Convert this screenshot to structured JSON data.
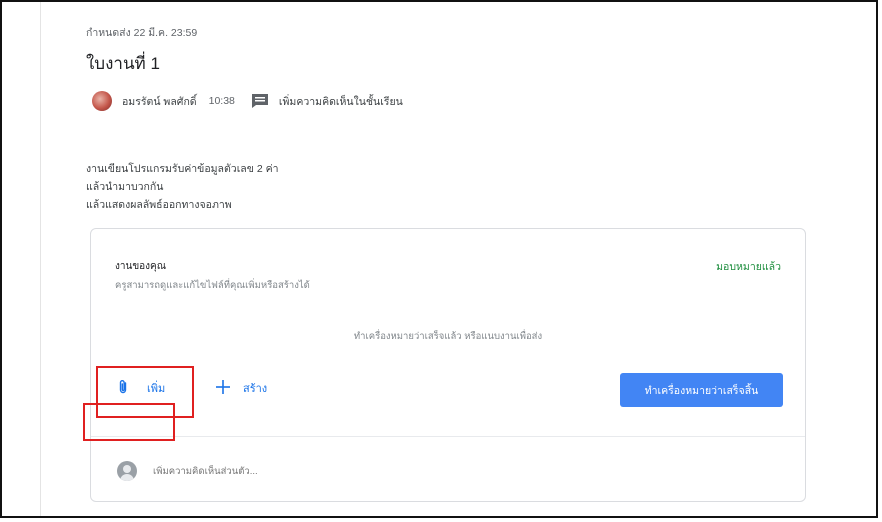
{
  "assignment": {
    "due": "กำหนดส่ง 22 มี.ค. 23:59",
    "title": "ใบงานที่ 1",
    "author": "อมรรัตน์ พลศักดิ์",
    "posted_time": "10:38",
    "class_comment_label": "เพิ่มความคิดเห็นในชั้นเรียน",
    "description": [
      "งานเขียนโปรแกรมรับค่าข้อมูลตัวเลข 2 ค่า",
      "แล้วนำมาบวกกัน",
      "แล้วแสดงผลลัพธ์ออกทางจอภาพ"
    ]
  },
  "your_work": {
    "title": "งานของคุณ",
    "status": "มอบหมายแล้ว",
    "status_color": "#1e8e3e",
    "subtitle": "ครูสามารถดูและแก้ไขไฟล์ที่คุณเพิ่มหรือสร้างได้",
    "hint": "ทำเครื่องหมายว่าเสร็จแล้ว หรือแนบงานเพื่อส่ง",
    "add_label": "เพิ่ม",
    "add_icon": "paperclip-icon",
    "create_label": "สร้าง",
    "create_icon": "plus-icon",
    "mark_done_label": "ทำเครื่องหมายว่าเสร็จสิ้น",
    "accent": "#4285f4"
  },
  "private_comment": {
    "placeholder": "เพิ่มความคิดเห็นส่วนตัว..."
  },
  "annotations": {
    "highlight_color": "#e02020"
  }
}
